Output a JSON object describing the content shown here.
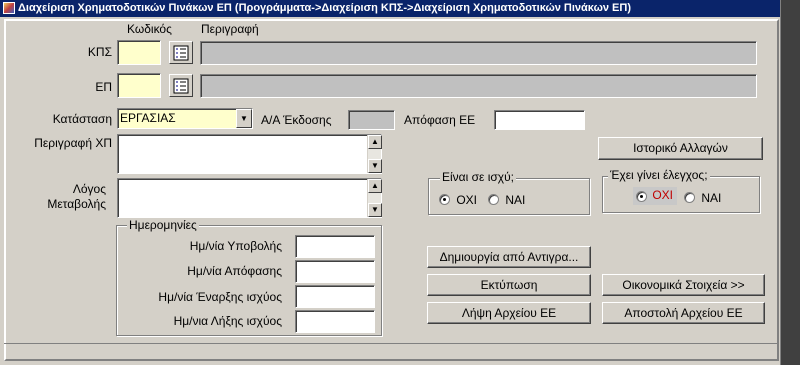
{
  "window": {
    "title": "Διαχείριση Χρηματοδοτικών Πινάκων ΕΠ (Προγράμματα->Διαχείριση ΚΠΣ->Διαχείριση Χρηματοδοτικών Πινάκων ΕΠ)"
  },
  "headers": {
    "code": "Κωδικός",
    "description": "Περιγραφή"
  },
  "kps": {
    "label": "ΚΠΣ",
    "code": "",
    "description": ""
  },
  "ep": {
    "label": "ΕΠ",
    "code": "",
    "description": ""
  },
  "status": {
    "label": "Κατάσταση",
    "value": "ΕΡΓΑΣΙΑΣ"
  },
  "version": {
    "label": "Α/Α Έκδοσης",
    "value": ""
  },
  "decision": {
    "label": "Απόφαση ΕΕ",
    "value": ""
  },
  "history_button": "Ιστορικό Αλλαγών",
  "description_xp": {
    "label": "Περιγραφή ΧΠ",
    "value": ""
  },
  "change_reason": {
    "label_line1": "Λόγος",
    "label_line2": "Μεταβολής",
    "value": ""
  },
  "in_force": {
    "title": "Είναι σε ισχύ;",
    "option_no": "ΟΧΙ",
    "option_yes": "ΝΑΙ",
    "selected": "ΟΧΙ"
  },
  "checked": {
    "title": "Έχει γίνει έλεγχος;",
    "option_no": "ΟΧΙ",
    "option_yes": "ΝΑΙ",
    "selected": "ΟΧΙ"
  },
  "dates": {
    "title": "Ημερομηνίες",
    "submission": {
      "label": "Ημ/νία Υποβολής",
      "value": ""
    },
    "decision": {
      "label": "Ημ/νία Απόφασης",
      "value": ""
    },
    "start": {
      "label": "Ημ/νία Έναρξης ισχύος",
      "value": ""
    },
    "end": {
      "label": "Ημ/νια Λήξης ισχύος",
      "value": ""
    }
  },
  "buttons": {
    "create_copy": "Δημιουργία από Αντιγρα...",
    "print": "Εκτύπωση",
    "get_file": "Λήψη Αρχείου ΕΕ",
    "financials": "Οικονομικά Στοιχεία >>",
    "send_file": "Αποστολή Αρχείου ΕΕ"
  },
  "colors": {
    "title_bar": "#0a246a",
    "window_bg": "#d4d0c8",
    "required_field": "#ffffcc",
    "checked_no_text": "#c00000"
  },
  "icons": {
    "lov": "list-icon",
    "dropdown": "chevron-down-icon",
    "scroll_up": "arrow-up-icon",
    "scroll_down": "arrow-down-icon"
  }
}
